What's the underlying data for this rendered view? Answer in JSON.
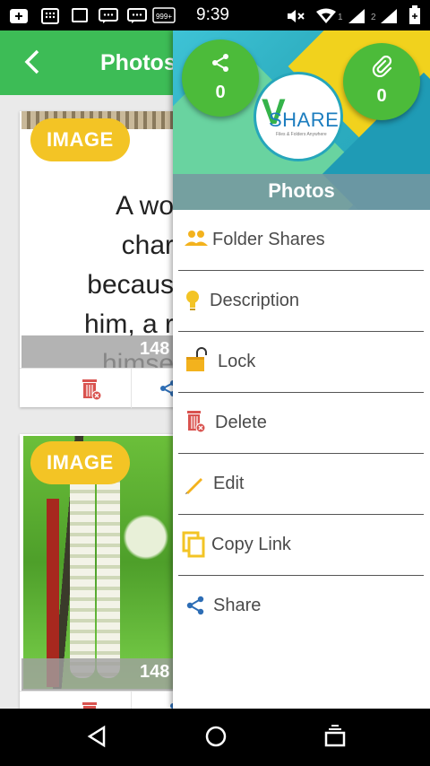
{
  "status_bar": {
    "time": "9:39",
    "notification_badge": "999+",
    "sim1": "1",
    "sim2": "2",
    "icons": [
      "add-box-icon",
      "dialpad-icon",
      "square-icon",
      "chat-icon",
      "chat-icon",
      "badge-icon",
      "mute-icon",
      "wifi-icon",
      "signal-icon",
      "signal-icon",
      "battery-icon"
    ]
  },
  "app_bar": {
    "title": "Photos",
    "back_icon": "back-arrow-icon"
  },
  "cards": [
    {
      "badge": "IMAGE",
      "count": "148",
      "quote_lines": "A wo\nchar\nbecaus\nhim, a r\nhimse"
    },
    {
      "badge": "IMAGE",
      "count": "148"
    }
  ],
  "drawer": {
    "share_count": "0",
    "attachment_count": "0",
    "logo_text": "SHARE",
    "logo_letter": "V",
    "logo_sub": "Files & Folders Anywhere",
    "title": "Photos",
    "menu": [
      {
        "label": "Folder Shares",
        "icon": "people-icon",
        "color": "#f3b21d"
      },
      {
        "label": "Description",
        "icon": "lightbulb-icon",
        "color": "#f3c425"
      },
      {
        "label": "Lock",
        "icon": "lock-open-icon",
        "color": "#f3b21d"
      },
      {
        "label": "Delete",
        "icon": "trash-icon",
        "color": "#d9534f"
      },
      {
        "label": "Edit",
        "icon": "pencil-icon",
        "color": "#f3b21d"
      },
      {
        "label": "Copy Link",
        "icon": "copy-icon",
        "color": "#f3c425"
      },
      {
        "label": "Share",
        "icon": "share-icon",
        "color": "#2d6db5"
      }
    ]
  },
  "nav_bar": {
    "back": "nav-back-icon",
    "home": "nav-home-icon",
    "recents": "nav-recents-icon"
  },
  "colors": {
    "accent_green": "#3dbc56",
    "badge_yellow": "#f3c425",
    "fab_green": "#4cbb3a"
  }
}
